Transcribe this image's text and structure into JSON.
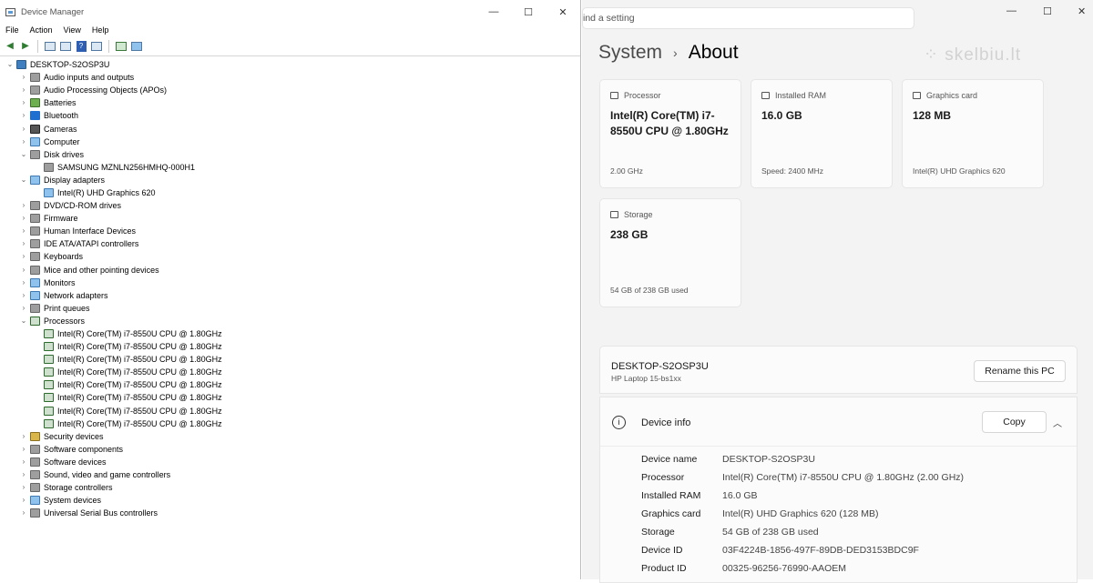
{
  "device_manager": {
    "title": "Device Manager",
    "menu": [
      "File",
      "Action",
      "View",
      "Help"
    ],
    "tree": [
      {
        "label": "DESKTOP-S2OSP3U",
        "level": 0,
        "chevron": "⌄",
        "icon": "computer"
      },
      {
        "label": "Audio inputs and outputs",
        "level": 1,
        "chevron": "›",
        "icon": "gray"
      },
      {
        "label": "Audio Processing Objects (APOs)",
        "level": 1,
        "chevron": "›",
        "icon": "gray"
      },
      {
        "label": "Batteries",
        "level": 1,
        "chevron": "›",
        "icon": "green"
      },
      {
        "label": "Bluetooth",
        "level": 1,
        "chevron": "›",
        "icon": "blue"
      },
      {
        "label": "Cameras",
        "level": 1,
        "chevron": "›",
        "icon": "dark"
      },
      {
        "label": "Computer",
        "level": 1,
        "chevron": "›",
        "icon": "monitor"
      },
      {
        "label": "Disk drives",
        "level": 1,
        "chevron": "⌄",
        "icon": "gray"
      },
      {
        "label": "SAMSUNG MZNLN256HMHQ-000H1",
        "level": 2,
        "chevron": "",
        "icon": "gray"
      },
      {
        "label": "Display adapters",
        "level": 1,
        "chevron": "⌄",
        "icon": "monitor"
      },
      {
        "label": "Intel(R) UHD Graphics 620",
        "level": 2,
        "chevron": "",
        "icon": "monitor"
      },
      {
        "label": "DVD/CD-ROM drives",
        "level": 1,
        "chevron": "›",
        "icon": "gray"
      },
      {
        "label": "Firmware",
        "level": 1,
        "chevron": "›",
        "icon": "gray"
      },
      {
        "label": "Human Interface Devices",
        "level": 1,
        "chevron": "›",
        "icon": "gray"
      },
      {
        "label": "IDE ATA/ATAPI controllers",
        "level": 1,
        "chevron": "›",
        "icon": "gray"
      },
      {
        "label": "Keyboards",
        "level": 1,
        "chevron": "›",
        "icon": "gray"
      },
      {
        "label": "Mice and other pointing devices",
        "level": 1,
        "chevron": "›",
        "icon": "gray"
      },
      {
        "label": "Monitors",
        "level": 1,
        "chevron": "›",
        "icon": "monitor"
      },
      {
        "label": "Network adapters",
        "level": 1,
        "chevron": "›",
        "icon": "monitor"
      },
      {
        "label": "Print queues",
        "level": 1,
        "chevron": "›",
        "icon": "gray"
      },
      {
        "label": "Processors",
        "level": 1,
        "chevron": "⌄",
        "icon": "chip"
      },
      {
        "label": "Intel(R) Core(TM) i7-8550U CPU @ 1.80GHz",
        "level": 2,
        "chevron": "",
        "icon": "chip"
      },
      {
        "label": "Intel(R) Core(TM) i7-8550U CPU @ 1.80GHz",
        "level": 2,
        "chevron": "",
        "icon": "chip"
      },
      {
        "label": "Intel(R) Core(TM) i7-8550U CPU @ 1.80GHz",
        "level": 2,
        "chevron": "",
        "icon": "chip"
      },
      {
        "label": "Intel(R) Core(TM) i7-8550U CPU @ 1.80GHz",
        "level": 2,
        "chevron": "",
        "icon": "chip"
      },
      {
        "label": "Intel(R) Core(TM) i7-8550U CPU @ 1.80GHz",
        "level": 2,
        "chevron": "",
        "icon": "chip"
      },
      {
        "label": "Intel(R) Core(TM) i7-8550U CPU @ 1.80GHz",
        "level": 2,
        "chevron": "",
        "icon": "chip"
      },
      {
        "label": "Intel(R) Core(TM) i7-8550U CPU @ 1.80GHz",
        "level": 2,
        "chevron": "",
        "icon": "chip"
      },
      {
        "label": "Intel(R) Core(TM) i7-8550U CPU @ 1.80GHz",
        "level": 2,
        "chevron": "",
        "icon": "chip"
      },
      {
        "label": "Security devices",
        "level": 1,
        "chevron": "›",
        "icon": "yellow"
      },
      {
        "label": "Software components",
        "level": 1,
        "chevron": "›",
        "icon": "gray"
      },
      {
        "label": "Software devices",
        "level": 1,
        "chevron": "›",
        "icon": "gray"
      },
      {
        "label": "Sound, video and game controllers",
        "level": 1,
        "chevron": "›",
        "icon": "gray"
      },
      {
        "label": "Storage controllers",
        "level": 1,
        "chevron": "›",
        "icon": "gray"
      },
      {
        "label": "System devices",
        "level": 1,
        "chevron": "›",
        "icon": "monitor"
      },
      {
        "label": "Universal Serial Bus controllers",
        "level": 1,
        "chevron": "›",
        "icon": "gray"
      }
    ]
  },
  "settings": {
    "search_text": "ind a setting",
    "breadcrumb_parent": "System",
    "breadcrumb_current": "About",
    "watermark": "skelbiu.lt",
    "cards": [
      {
        "label": "Processor",
        "value": "Intel(R) Core(TM) i7-8550U CPU @ 1.80GHz",
        "sub": "2.00 GHz"
      },
      {
        "label": "Installed RAM",
        "value": "16.0 GB",
        "sub": "Speed: 2400 MHz"
      },
      {
        "label": "Graphics card",
        "value": "128 MB",
        "sub": "Intel(R) UHD Graphics 620"
      },
      {
        "label": "Storage",
        "value": "238 GB",
        "sub": "54 GB of 238 GB used"
      }
    ],
    "pc_name": "DESKTOP-S2OSP3U",
    "pc_model": "HP Laptop 15-bs1xx",
    "rename_label": "Rename this PC",
    "device_info_title": "Device info",
    "copy_label": "Copy",
    "specs": [
      {
        "key": "Device name",
        "value": "DESKTOP-S2OSP3U"
      },
      {
        "key": "Processor",
        "value": "Intel(R) Core(TM) i7-8550U CPU @ 1.80GHz (2.00 GHz)"
      },
      {
        "key": "Installed RAM",
        "value": "16.0 GB"
      },
      {
        "key": "Graphics card",
        "value": "Intel(R) UHD Graphics 620 (128 MB)"
      },
      {
        "key": "Storage",
        "value": "54 GB of 238 GB used"
      },
      {
        "key": "Device ID",
        "value": "03F4224B-1856-497F-89DB-DED3153BDC9F"
      },
      {
        "key": "Product ID",
        "value": "00325-96256-76990-AAOEM"
      }
    ]
  }
}
